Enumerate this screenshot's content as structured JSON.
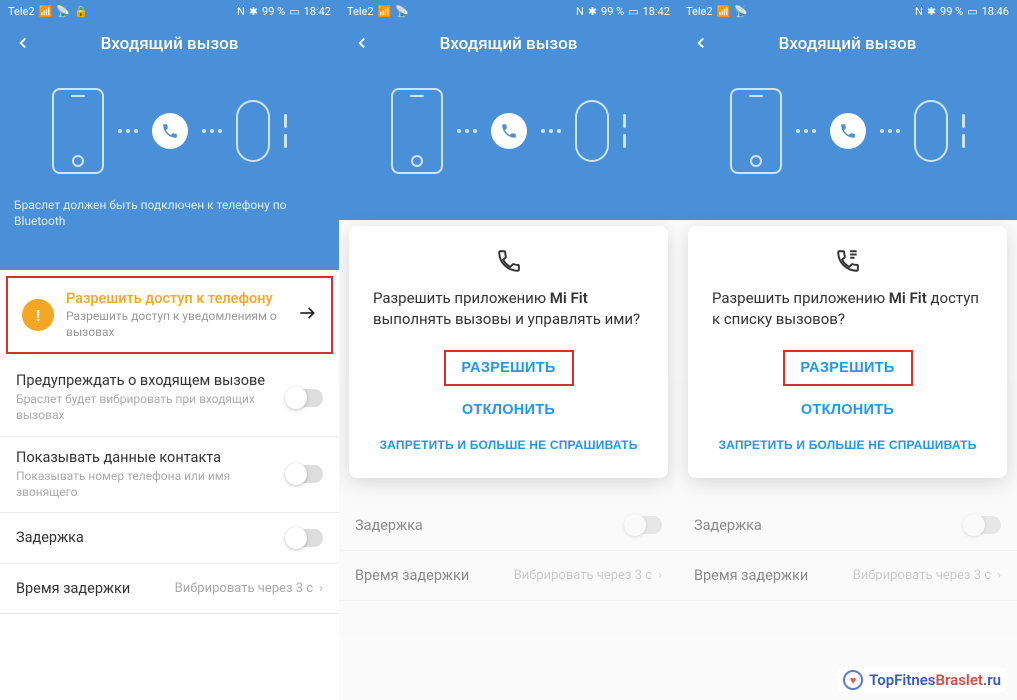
{
  "status": {
    "carrier": "Tele2",
    "nfc": "N",
    "bt": "✱",
    "battery": "99 %",
    "time1": "18:42",
    "time2": "18:42",
    "time3": "18:46"
  },
  "header": {
    "title": "Входящий вызов",
    "caption": "Браслет должен быть подключен к телефону по Bluetooth"
  },
  "warn": {
    "title": "Разрешить доступ к телефону",
    "sub": "Разрешить доступ к уведомлениям о вызовах",
    "badge": "!"
  },
  "settings": {
    "alert_title": "Предупреждать о входящем вызове",
    "alert_sub": "Браслет будет вибрировать при входящих вызовах",
    "contact_title": "Показывать данные контакта",
    "contact_sub": "Показывать номер телефона или имя звонящего",
    "delay_label": "Задержка",
    "delaytime_label": "Время задержки",
    "delaytime_value": "Вибрировать через 3 с"
  },
  "dialog1": {
    "text_pre": "Разрешить приложению ",
    "text_app": "Mi Fit",
    "text_post": " выполнять вызовы и управлять ими?",
    "allow": "РАЗРЕШИТЬ",
    "deny": "ОТКЛОНИТЬ",
    "never": "ЗАПРЕТИТЬ И БОЛЬШЕ НЕ СПРАШИВАТЬ"
  },
  "dialog2": {
    "text_pre": "Разрешить приложению ",
    "text_app": "Mi Fit",
    "text_post": " доступ к списку вызовов?",
    "allow": "РАЗРЕШИТЬ",
    "deny": "ОТКЛОНИТЬ",
    "never": "ЗАПРЕТИТЬ И БОЛЬШЕ НЕ СПРАШИВАТЬ"
  },
  "watermark": {
    "top": "TopFitnes",
    "braslet": "Braslet",
    "ru": ".ru"
  }
}
